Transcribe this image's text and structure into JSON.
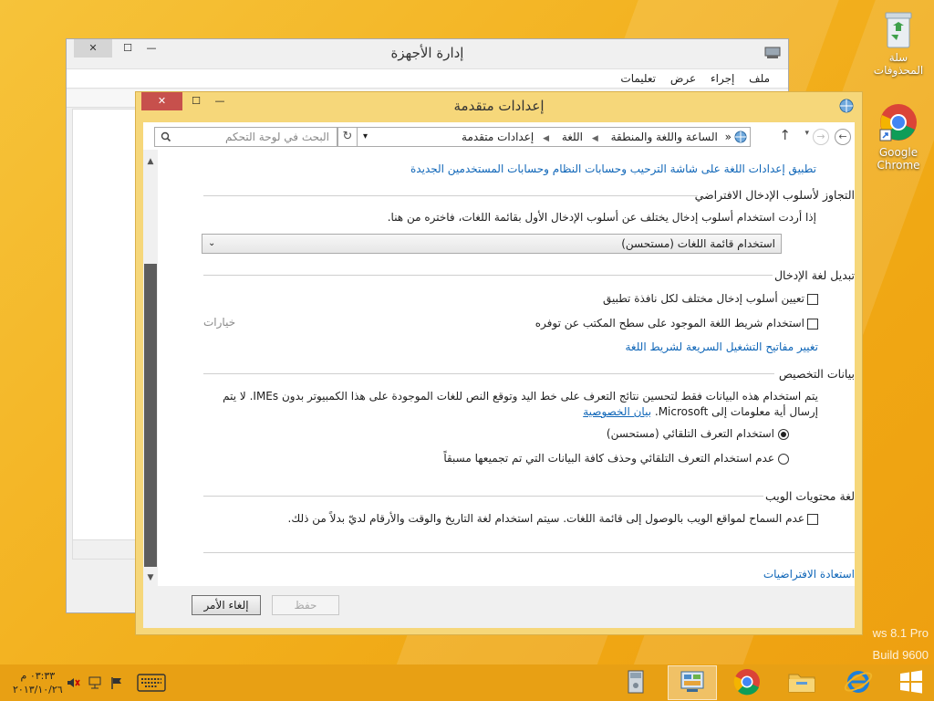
{
  "desktop": {
    "watermark_line1": "ws 8.1 Pro",
    "watermark_line2": "Build 9600",
    "icons": [
      {
        "label": "سلة المحذوفات",
        "icon": "recycle-bin-icon"
      },
      {
        "label": "Google Chrome",
        "icon": "chrome-icon"
      }
    ]
  },
  "device_manager": {
    "title": "إدارة الأجهزة",
    "menu": [
      "ملف",
      "إجراء",
      "عرض",
      "تعليمات"
    ]
  },
  "advanced_settings": {
    "title": "إعدادات متقدمة",
    "address": {
      "root": "«",
      "crumbs": [
        "الساعة واللغة والمنطقة",
        "اللغة",
        "إعدادات متقدمة"
      ]
    },
    "search_placeholder": "البحث في لوحة التحكم",
    "top_link": "تطبيق إعدادات اللغة على شاشة الترحيب وحسابات النظام وحسابات المستخدمين الجديدة",
    "override_section": {
      "title": "التجاوز لأسلوب الإدخال الافتراضي",
      "description": "إذا أردت استخدام أسلوب إدخال يختلف عن أسلوب الإدخال الأول بقائمة اللغات، فاختره من هنا.",
      "dropdown_value": "استخدام قائمة اللغات (مستحسن)"
    },
    "switch_section": {
      "title": "تبديل لغة الإدخال",
      "option1": "تعيين أسلوب إدخال مختلف لكل نافذة تطبيق",
      "option2": "استخدام شريط اللغة الموجود على سطح المكتب عن توفره",
      "options_label": "خيارات",
      "hotkeys_link": "تغيير مفاتيح التشغيل السريعة لشريط اللغة"
    },
    "personalization_section": {
      "title": "بيانات التخصيص",
      "description_line1": "يتم استخدام هذه البيانات فقط لتحسين نتائج التعرف على خط اليد وتوقع النص للغات الموجودة على هذا الكمبيوتر بدون IMEs. لا يتم",
      "description_line2": "إرسال أية معلومات إلى Microsoft.",
      "privacy_link": "بيان الخصوصية",
      "radio1": "استخدام التعرف التلقائي (مستحسن)",
      "radio2": "عدم استخدام التعرف التلقائي وحذف كافة البيانات التي تم تجميعها مسبقاً"
    },
    "web_section": {
      "title": "لغة محتويات الويب",
      "option": "عدم السماح لمواقع الويب بالوصول إلى قائمة اللغات. سيتم استخدام لغة التاريخ والوقت والأرقام لديّ بدلاً من ذلك."
    },
    "restore_link": "استعادة الافتراضيات",
    "buttons": {
      "save": "حفظ",
      "cancel": "إلغاء الأمر"
    }
  },
  "taskbar": {
    "time": "٠٣:٣٣ م",
    "date": "٢٠١٣/١٠/٢٦",
    "items": [
      "device-manager-icon",
      "control-panel-icon",
      "chrome-icon",
      "file-explorer-icon",
      "internet-explorer-icon"
    ]
  }
}
